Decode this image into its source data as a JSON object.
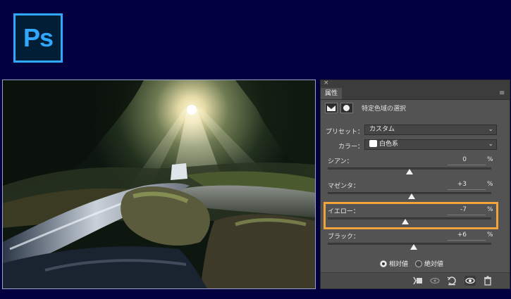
{
  "logo": {
    "text": "Ps"
  },
  "panel": {
    "close": "×",
    "tab": "属性",
    "menu": "≡",
    "header_title": "特定色域の選択",
    "preset_label": "プリセット：",
    "preset_value": "カスタム",
    "color_label": "カラー：",
    "color_value": "白色系",
    "sliders": [
      {
        "name": "シアン：",
        "value": "0",
        "unit": "%",
        "level": 0
      },
      {
        "name": "マゼンタ：",
        "value": "+3",
        "unit": "%",
        "level": 3
      },
      {
        "name": "イエロー：",
        "value": "-7",
        "unit": "%",
        "level": -7
      },
      {
        "name": "ブラック：",
        "value": "+6",
        "unit": "%",
        "level": 6
      }
    ],
    "radio_relative": "相対値",
    "radio_absolute": "絶対値"
  },
  "colors": {
    "accent": "#31a8ff",
    "highlight": "#f2a33a",
    "background": "#02003f",
    "panel": "#535353"
  }
}
